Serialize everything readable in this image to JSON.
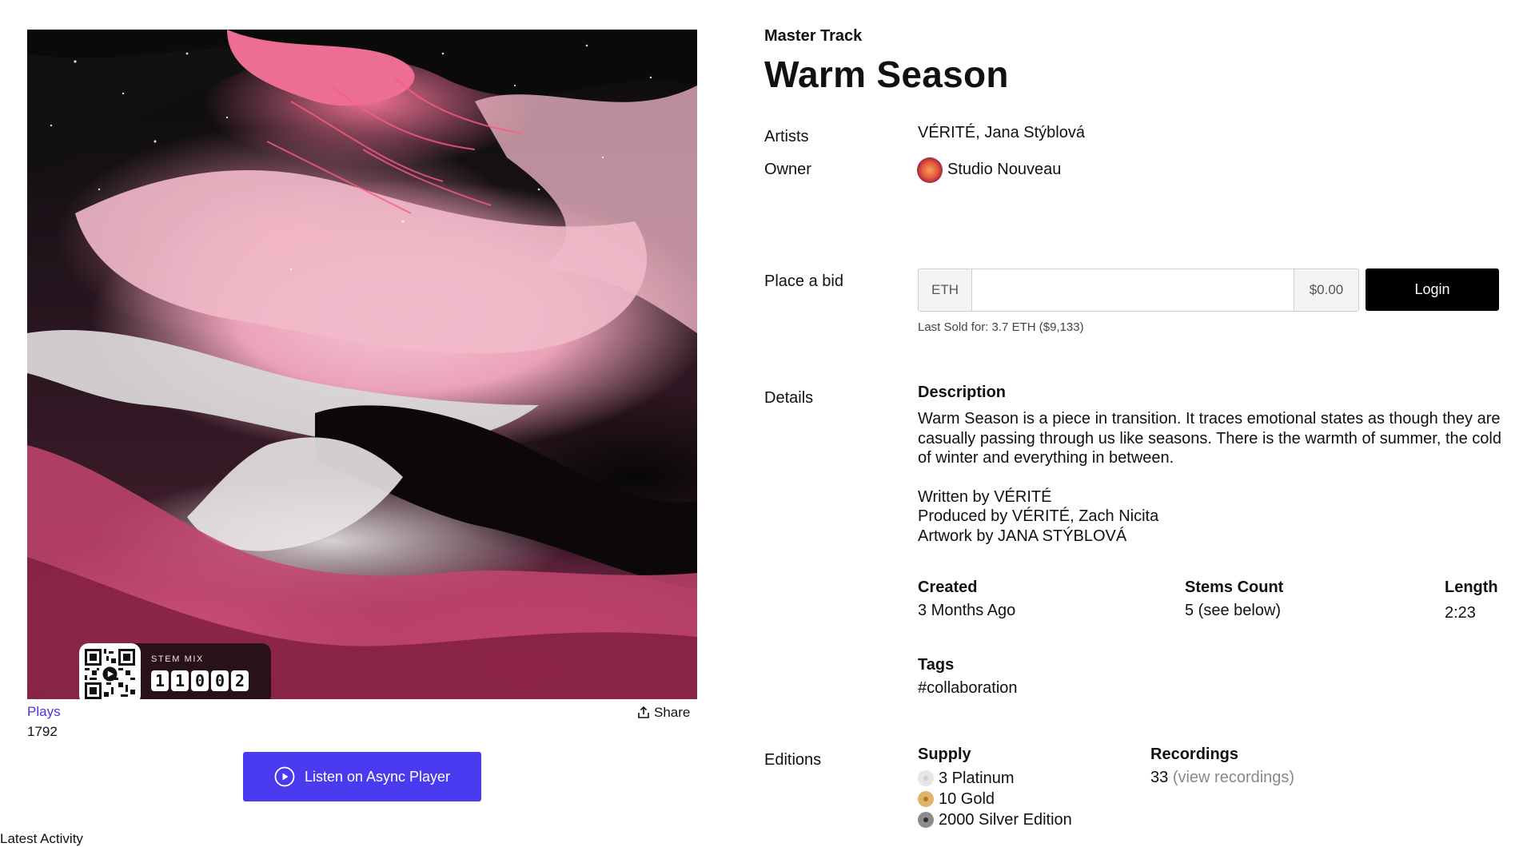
{
  "artwork": {
    "alt": "Warm Season cover artwork",
    "badge": {
      "label": "STEM MIX",
      "digits": [
        "1",
        "1",
        "0",
        "0",
        "2"
      ]
    }
  },
  "plays": {
    "label": "Plays",
    "value": "1792"
  },
  "share": {
    "label": "Share",
    "icon": "share-icon"
  },
  "listen_button": {
    "label": "Listen on Async Player",
    "icon": "play-circle-icon",
    "color": "#4a3af0"
  },
  "header": {
    "eyebrow": "Master Track",
    "title": "Warm Season"
  },
  "artists": {
    "label": "Artists",
    "value": "VÉRITÉ, Jana Stýblová"
  },
  "owner": {
    "label": "Owner",
    "value": "Studio Nouveau"
  },
  "bid": {
    "label": "Place a bid",
    "currency": "ETH",
    "input_value": "",
    "usd": "$0.00",
    "login_label": "Login",
    "last_sold": "Last Sold for: 3.7 ETH ($9,133)"
  },
  "details": {
    "label": "Details",
    "description_heading": "Description",
    "description": "Warm Season is a piece in transition. It traces emotional states as though they are casually passing through us like seasons. There is the warmth of summer, the cold of winter and everything in between.",
    "credits": [
      "Written by VÉRITÉ",
      "Produced by VÉRITÉ, Zach Nicita",
      "Artwork by JANA STÝBLOVÁ"
    ],
    "created": {
      "label": "Created",
      "value": "3 Months Ago"
    },
    "stems": {
      "label": "Stems Count",
      "value": "5 (see below)"
    },
    "length": {
      "label": "Length",
      "value": "2:23"
    },
    "tags": {
      "label": "Tags",
      "value": "#collaboration"
    }
  },
  "editions": {
    "label": "Editions",
    "supply_label": "Supply",
    "supply": [
      {
        "text": "3 Platinum",
        "color": "#e6e6e6"
      },
      {
        "text": "10 Gold",
        "color": "#e2b469"
      },
      {
        "text": "2000 Silver Edition",
        "color": "#8c8c8c"
      }
    ],
    "recordings_label": "Recordings",
    "recordings_count": "33",
    "recordings_link": "(view recordings)"
  },
  "recent_activity": "Latest Activity"
}
